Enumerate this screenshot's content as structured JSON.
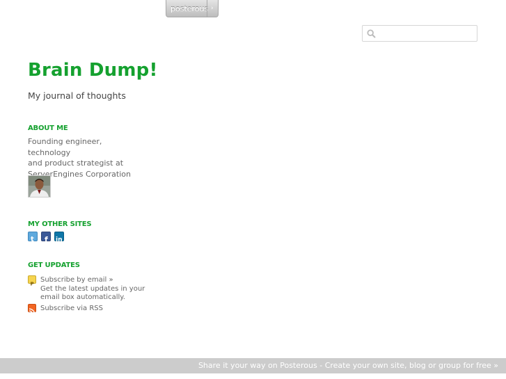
{
  "top_bar": {
    "posterous_label": "posterous",
    "arrow": "›"
  },
  "search": {
    "placeholder": ""
  },
  "site": {
    "title": "Brain Dump!",
    "tagline": "My journal of thoughts"
  },
  "about": {
    "heading": "ABOUT ME",
    "lines": [
      "Founding engineer, technology",
      "and product strategist at",
      "ServerEngines Corporation"
    ]
  },
  "other_sites": {
    "heading": "MY OTHER SITES",
    "icons": [
      "twitter-icon",
      "facebook-icon",
      "linkedin-icon"
    ]
  },
  "updates": {
    "heading": "GET UPDATES",
    "email_link": "Subscribe by email »",
    "email_desc_1": "Get the latest updates in your",
    "email_desc_2": "email box automatically.",
    "rss_link": "Subscribe via RSS"
  },
  "footer": {
    "text": "Share it your way on Posterous - Create your own site, blog or group for free »"
  },
  "colors": {
    "accent": "#15a12f",
    "footer_bg": "#cccccc",
    "twitter": "#5ea9dd",
    "facebook": "#3b5998",
    "linkedin": "#0e76a8",
    "rss": "#f26522"
  }
}
